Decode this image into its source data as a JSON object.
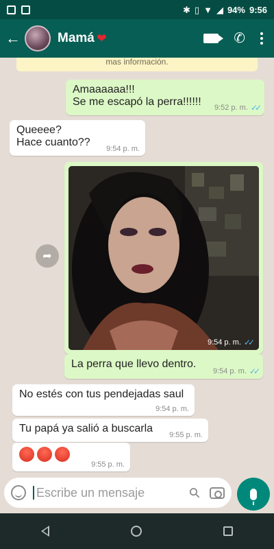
{
  "status_bar": {
    "battery": "94%",
    "time": "9:56"
  },
  "toolbar": {
    "contact_name": "Mamá",
    "back_icon": "arrow-left-icon",
    "video_icon": "video-call-icon",
    "call_icon": "phone-icon",
    "menu_icon": "kebab-menu-icon"
  },
  "system_notice": "mas información.",
  "messages": [
    {
      "from": "me",
      "lines": [
        "Amaaaaaa!!!",
        "Se me escapó la perra!!!!!!"
      ],
      "time": "9:52 p. m.",
      "read": true
    },
    {
      "from": "them",
      "lines": [
        "Queeee?",
        "Hace cuanto??"
      ],
      "time": "9:54 p. m."
    },
    {
      "from": "me",
      "type": "photo",
      "time": "9:54 p. m.",
      "read": true
    },
    {
      "from": "me",
      "lines": [
        "La perra que llevo dentro."
      ],
      "time": "9:54 p. m.",
      "read": true
    },
    {
      "from": "them",
      "lines": [
        "No estés con tus pendejadas saul"
      ],
      "time": "9:54 p. m."
    },
    {
      "from": "them",
      "lines": [
        "Tu papá ya salió a buscarla"
      ],
      "time": "9:55 p. m."
    },
    {
      "from": "them",
      "type": "emoji",
      "emoji_count": 3,
      "emoji_icon": "angry-face-icon",
      "time": "9:55 p. m."
    }
  ],
  "input": {
    "placeholder": "Escribe un mensaje"
  },
  "colors": {
    "header": "#075e54",
    "outgoing_bubble": "#dcf8c6",
    "incoming_bubble": "#ffffff",
    "read_ticks": "#4fb6ec",
    "mic_button": "#00897b"
  }
}
